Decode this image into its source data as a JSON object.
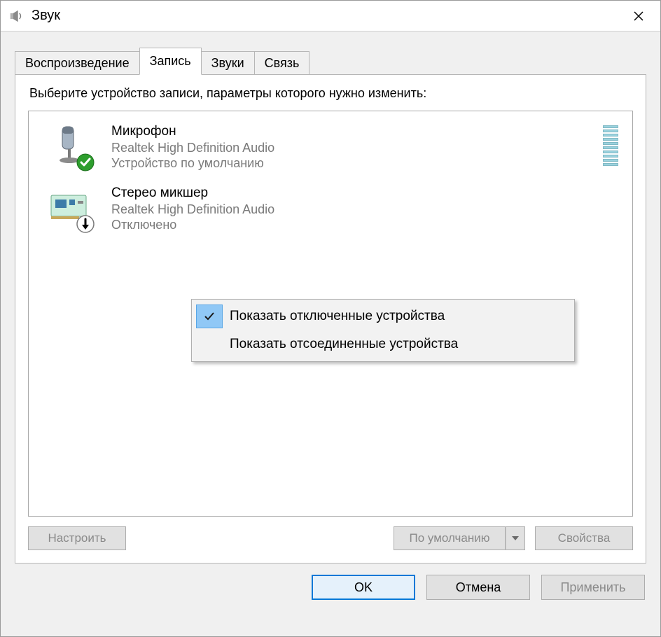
{
  "window": {
    "title": "Звук",
    "close_glyph": "✕"
  },
  "tabs": [
    {
      "label": "Воспроизведение",
      "active": false
    },
    {
      "label": "Запись",
      "active": true
    },
    {
      "label": "Звуки",
      "active": false
    },
    {
      "label": "Связь",
      "active": false
    }
  ],
  "instruction": "Выберите устройство записи, параметры которого нужно изменить:",
  "devices": [
    {
      "name": "Микрофон",
      "driver": "Realtek High Definition Audio",
      "status": "Устройство по умолчанию",
      "icon": "microphone",
      "badge": "default",
      "meter": true
    },
    {
      "name": "Стерео микшер",
      "driver": "Realtek High Definition Audio",
      "status": "Отключено",
      "icon": "soundcard",
      "badge": "disabled",
      "meter": false
    }
  ],
  "context_menu": {
    "items": [
      {
        "label": "Показать отключенные устройства",
        "checked": true
      },
      {
        "label": "Показать отсоединенные устройства",
        "checked": false
      }
    ]
  },
  "panel_buttons": {
    "configure": "Настроить",
    "set_default": "По умолчанию",
    "properties": "Свойства"
  },
  "dialog_buttons": {
    "ok": "OK",
    "cancel": "Отмена",
    "apply": "Применить"
  }
}
